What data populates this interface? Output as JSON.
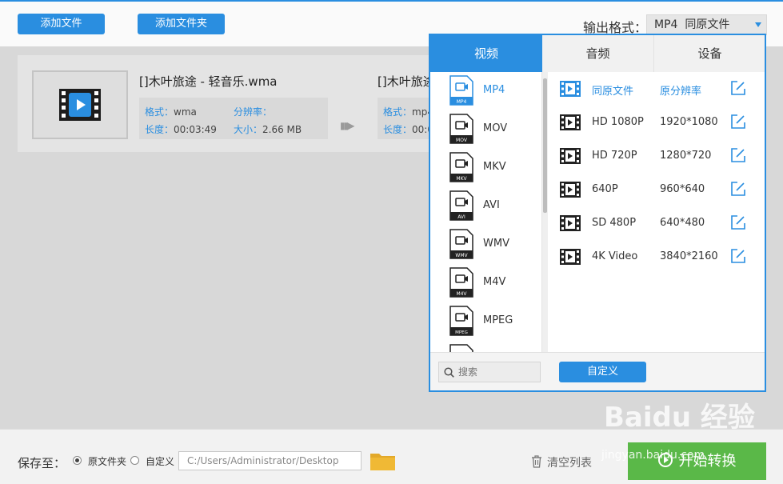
{
  "toolbar": {
    "add_file": "添加文件",
    "add_folder": "添加文件夹",
    "output_format_label": "输出格式：",
    "output_format_value": "MP4  同原文件"
  },
  "file": {
    "source_name": "[]木叶旅途 - 轻音乐.wma",
    "target_name": "[]木叶旅途",
    "source_meta": {
      "format_key": "格式：",
      "format_val": "wma",
      "res_key": "分辨率：",
      "res_val": "",
      "length_key": "长度：",
      "length_val": "00:03:49",
      "size_key": "大小：",
      "size_val": "2.66 MB"
    },
    "target_meta": {
      "format_key": "格式：",
      "format_val": "mp4",
      "length_key": "长度：",
      "length_val": "00:0"
    },
    "arrow_glyph": "▮▮▶"
  },
  "dropdown": {
    "tabs": [
      {
        "label": "视频"
      },
      {
        "label": "音频"
      },
      {
        "label": "设备"
      }
    ],
    "formats": [
      {
        "label": "MP4",
        "badge": "MP4"
      },
      {
        "label": "MOV",
        "badge": "MOV"
      },
      {
        "label": "MKV",
        "badge": "MKV"
      },
      {
        "label": "AVI",
        "badge": "AVI"
      },
      {
        "label": "WMV",
        "badge": "WMV"
      },
      {
        "label": "M4V",
        "badge": "M4V"
      },
      {
        "label": "MPEG",
        "badge": "MPEG"
      }
    ],
    "presets": [
      {
        "name": "同原文件",
        "res": "原分辨率"
      },
      {
        "name": "HD 1080P",
        "res": "1920*1080"
      },
      {
        "name": "HD 720P",
        "res": "1280*720"
      },
      {
        "name": "640P",
        "res": "960*640"
      },
      {
        "name": "SD 480P",
        "res": "640*480"
      },
      {
        "name": "4K Video",
        "res": "3840*2160"
      }
    ],
    "search_placeholder": "搜索",
    "custom_button": "自定义"
  },
  "bottom": {
    "save_to": "保存至：",
    "radio_original": "原文件夹",
    "radio_custom": "自定义",
    "path": "C:/Users/Administrator/Desktop",
    "clear_list": "清空列表",
    "start": "开始转换"
  },
  "watermark": {
    "text": "Baidu 经验",
    "url": "jingyan.baidu.com"
  },
  "colors": {
    "accent": "#2a8ee0",
    "start": "#5ab848"
  }
}
